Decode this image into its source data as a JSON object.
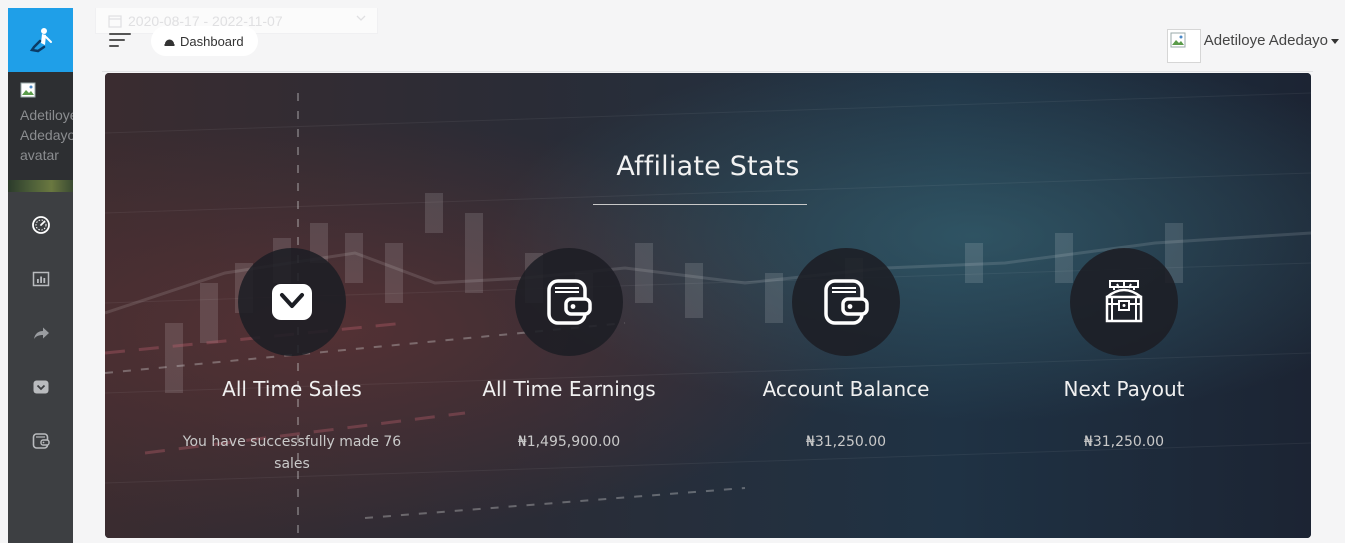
{
  "sidebar": {
    "profile_alt_text": "Adetiloye Adedayo avatar",
    "nav": [
      {
        "icon": "dashboard-gauge-icon"
      },
      {
        "icon": "stats-chart-icon"
      },
      {
        "icon": "share-arrow-icon"
      },
      {
        "icon": "shopping-bag-icon"
      },
      {
        "icon": "wallet-icon"
      }
    ]
  },
  "topbar": {
    "date_range": "2020-08-17 - 2022-11-07",
    "breadcrumb": "Dashboard",
    "user_name": "Adetiloye Adedayo"
  },
  "hero": {
    "title": "Affiliate Stats",
    "cards": [
      {
        "icon": "shopping-bag-icon",
        "label": "All Time Sales",
        "value": "You have successfully made 76 sales"
      },
      {
        "icon": "wallet-icon",
        "label": "All Time Earnings",
        "value": "₦1,495,900.00"
      },
      {
        "icon": "wallet-icon",
        "label": "Account Balance",
        "value": "₦31,250.00"
      },
      {
        "icon": "treasure-chest-icon",
        "label": "Next Payout",
        "value": "₦31,250.00"
      }
    ]
  },
  "colors": {
    "brand": "#1f9fe8",
    "sidebar": "#3d3f42",
    "hero_dark": "#1a1d25"
  }
}
